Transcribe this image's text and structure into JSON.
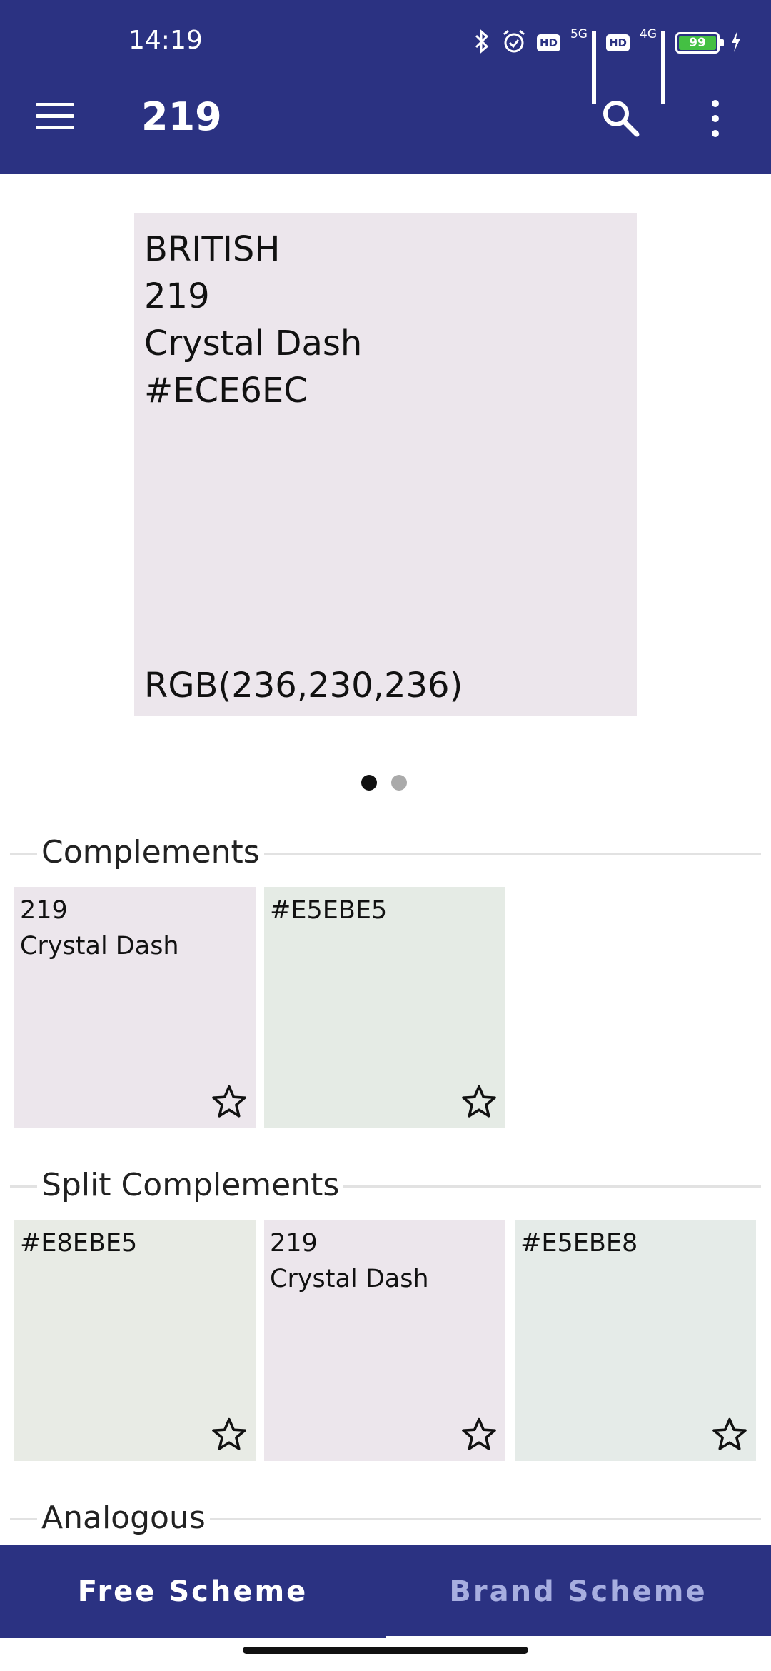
{
  "status_bar": {
    "time": "14:19",
    "net1": "5G",
    "net2": "4G",
    "hd": "HD",
    "battery": "99"
  },
  "app_bar": {
    "title": "219",
    "icons": [
      "menu-icon",
      "search-icon",
      "more-vert-icon"
    ]
  },
  "hero": {
    "brand": "BRITISH",
    "code": "219",
    "name": "Crystal Dash",
    "hex": "#ECE6EC",
    "rgb": "RGB(236,230,236)",
    "color": "#ece6ec"
  },
  "pager": {
    "pages": 2,
    "active": 1
  },
  "sections": {
    "complements": {
      "label": "Complements",
      "cards": [
        {
          "line1": "219",
          "line2": "Crystal Dash",
          "color": "#ece6ec"
        },
        {
          "line1": "#E5EBE5",
          "line2": "",
          "color": "#e5ebe5"
        }
      ]
    },
    "split_complements": {
      "label": "Split Complements",
      "cards": [
        {
          "line1": "#E8EBE5",
          "line2": "",
          "color": "#e8ebe5"
        },
        {
          "line1": "219",
          "line2": "Crystal Dash",
          "color": "#ece6ec"
        },
        {
          "line1": "#E5EBE8",
          "line2": "",
          "color": "#e5ebe8"
        }
      ]
    },
    "analogous": {
      "label": "Analogous"
    }
  },
  "bottom_nav": {
    "free": "Free Scheme",
    "brand": "Brand Scheme",
    "active": "brand"
  }
}
